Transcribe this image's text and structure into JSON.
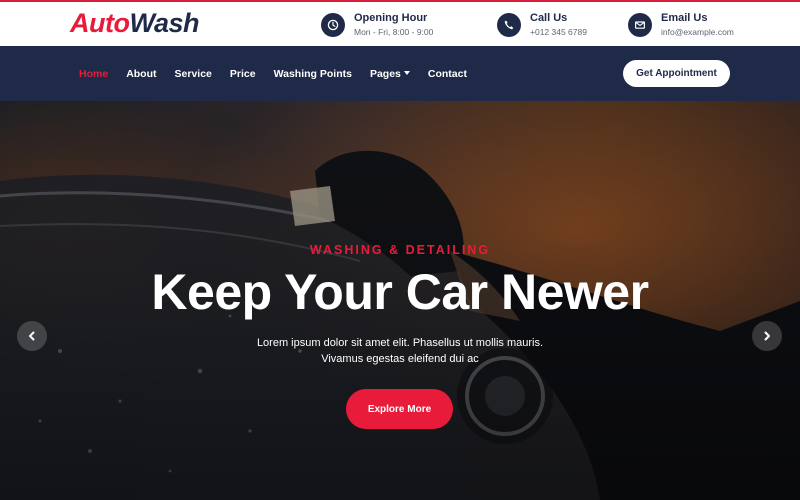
{
  "brand": {
    "part1": "Auto",
    "part2": "Wash"
  },
  "contact": [
    {
      "title": "Opening Hour",
      "sub": "Mon - Fri, 8:00 - 9:00",
      "icon": "clock-icon"
    },
    {
      "title": "Call Us",
      "sub": "+012 345 6789",
      "icon": "phone-icon"
    },
    {
      "title": "Email Us",
      "sub": "info@example.com",
      "icon": "envelope-icon"
    }
  ],
  "nav": {
    "items": [
      {
        "label": "Home",
        "active": true
      },
      {
        "label": "About"
      },
      {
        "label": "Service"
      },
      {
        "label": "Price"
      },
      {
        "label": "Washing Points"
      },
      {
        "label": "Pages",
        "dropdown": true
      },
      {
        "label": "Contact"
      }
    ],
    "cta": "Get Appointment"
  },
  "hero": {
    "kicker": "WASHING & DETAILING",
    "title": "Keep Your Car Newer",
    "description": "Lorem ipsum dolor sit amet elit. Phasellus ut mollis mauris. Vivamus egestas eleifend dui ac",
    "button": "Explore More"
  },
  "colors": {
    "primary": "#e81c3a",
    "navy": "#1f2a48"
  }
}
